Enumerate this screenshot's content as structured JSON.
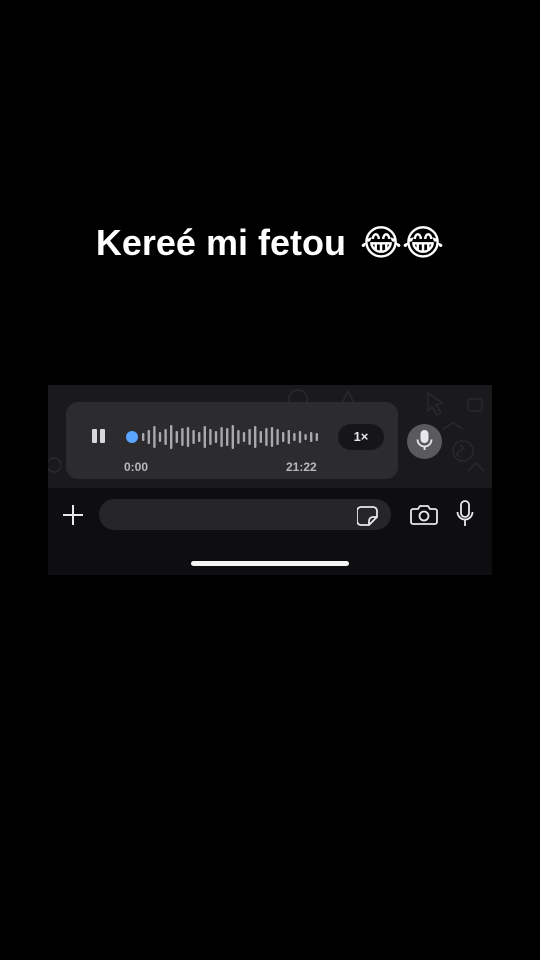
{
  "caption": {
    "text": "Kereé mi fetou",
    "emoji": "😂😂"
  },
  "voice_message": {
    "elapsed": "0:00",
    "duration": "21:22",
    "speed_label": "1×",
    "playback_progress": 0.0
  },
  "icons": {
    "pause": "pause-icon",
    "send_voice": "microphone-icon",
    "attach": "plus-icon",
    "sticker": "sticker-icon",
    "camera": "camera-icon",
    "record": "microphone-icon"
  },
  "colors": {
    "background": "#000000",
    "scrubber": "#5aa6ff",
    "bubble": "#2c2c2e",
    "chat_bg": "#1a1a1c"
  }
}
